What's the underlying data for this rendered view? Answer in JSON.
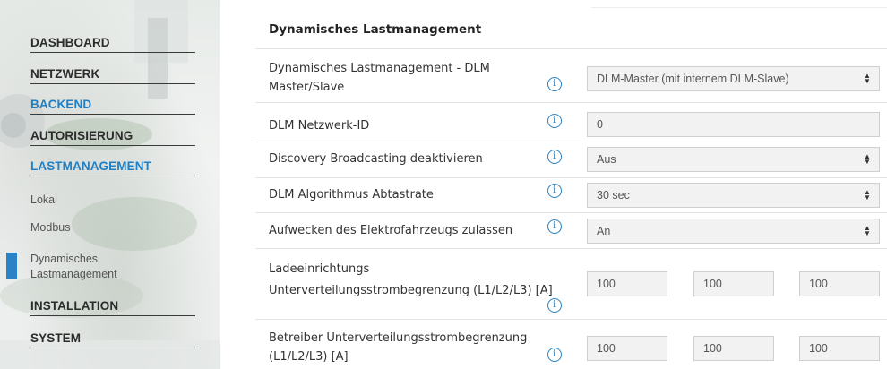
{
  "sidebar": {
    "items": [
      {
        "label": "DASHBOARD"
      },
      {
        "label": "NETZWERK"
      },
      {
        "label": "BACKEND"
      },
      {
        "label": "AUTORISIERUNG"
      },
      {
        "label": "LASTMANAGEMENT"
      },
      {
        "label": "INSTALLATION"
      },
      {
        "label": "SYSTEM"
      }
    ],
    "subitems": [
      {
        "label": "Lokal"
      },
      {
        "label": "Modbus"
      },
      {
        "label_line1": "Dynamisches",
        "label_line2": "Lastmanagement"
      }
    ],
    "accent_color": "#1e7fc4"
  },
  "main": {
    "section_title": "Dynamisches Lastmanagement",
    "rows": [
      {
        "label_line1": "Dynamisches Lastmanagement - DLM",
        "label_line2": "Master/Slave",
        "value": "DLM-Master (mit internem DLM-Slave)",
        "type": "select"
      },
      {
        "label": "DLM Netzwerk-ID",
        "value": "0",
        "type": "input"
      },
      {
        "label": "Discovery Broadcasting deaktivieren",
        "value": "Aus",
        "type": "select"
      },
      {
        "label": "DLM Algorithmus Abtastrate",
        "value": "30 sec",
        "type": "select"
      },
      {
        "label": "Aufwecken des Elektrofahrzeugs zulassen",
        "value": "An",
        "type": "select"
      },
      {
        "label_line1": "Ladeeinrichtungs",
        "label_line2": "Unterverteilungsstrombegrenzung (L1/L2/L3) [A]",
        "values": [
          "100",
          "100",
          "100"
        ],
        "type": "triple"
      },
      {
        "label_line1": "Betreiber Unterverteilungsstrombegrenzung",
        "label_line2": "(L1/L2/L3) [A]",
        "values": [
          "100",
          "100",
          "100"
        ],
        "type": "triple"
      }
    ],
    "info_icon": "info-circle-icon"
  }
}
